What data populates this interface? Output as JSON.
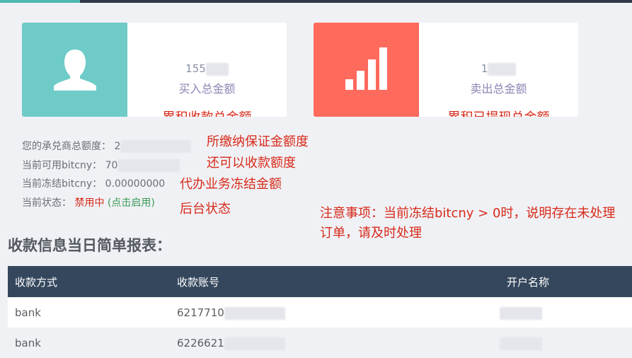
{
  "cards": [
    {
      "value": "155",
      "label": "买入总金额",
      "note": "累积收款总金额",
      "color": "#6ecbc7",
      "icon": "user-icon"
    },
    {
      "value": "1",
      "label": "卖出总金额",
      "note": "累积已提现总金额",
      "color": "#fe6a5c",
      "icon": "signal-bars-icon"
    }
  ],
  "info": {
    "total_limit_label": "您的承兑商总额度：",
    "total_limit_value": "2",
    "available_label": "当前可用bitcny：",
    "available_value": "70",
    "frozen_label": "当前冻结bitcny：",
    "frozen_value": "0.00000000",
    "status_label": "当前状态：",
    "status_value": "禁用中",
    "enable_link": "(点击启用)"
  },
  "annotations": {
    "deposit": "所缴纳保证金额度",
    "collectable": "还可以收款额度",
    "frozen": "代办业务冻结金额",
    "status": "后台状态",
    "notice": "注意事项：当前冻结bitcny > 0时，说明存在未处理订单，请及时处理"
  },
  "report": {
    "title": "收款信息当日简单报表：",
    "headers": [
      "收款方式",
      "收款账号",
      "开户名称"
    ],
    "rows": [
      {
        "method": "bank",
        "account": "6217710"
      },
      {
        "method": "bank",
        "account": "6226621"
      }
    ]
  }
}
